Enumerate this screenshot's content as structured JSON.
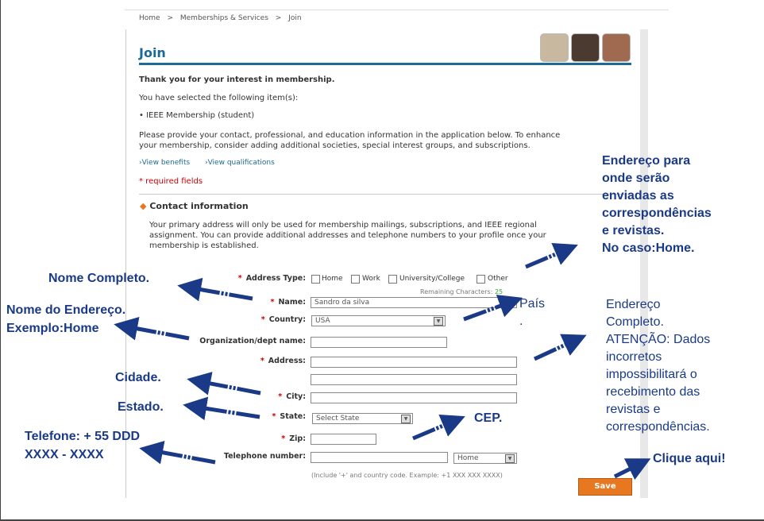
{
  "breadcrumb": {
    "home": "Home",
    "memberships": "Memberships & Services",
    "current": "Join"
  },
  "sep": ">",
  "page": {
    "title": "Join"
  },
  "intro": {
    "thanks": "Thank you for your interest in membership.",
    "selected": "You have selected the following item(s):",
    "item": "IEEE Membership (student)",
    "info1": "Please provide your contact, professional, and education information in the application below. To enhance",
    "info2": "your membership, consider adding additional societies, special interest groups, and subscriptions.",
    "view_benefits": "›View benefits",
    "view_qualifications": "›View qualifications",
    "required": "* required fields"
  },
  "contact": {
    "heading": "Contact information",
    "desc1": "Your primary address will only be used for membership mailings, subscriptions, and IEEE regional",
    "desc2": "assignment. You can provide additional addresses and telephone numbers to your profile once your",
    "desc3": "membership is established."
  },
  "form": {
    "required_marker": "*",
    "address_type_label": "Address Type:",
    "address_types": [
      "Home",
      "Work",
      "University/College",
      "Other"
    ],
    "remaining_label": "Remaining Characters:",
    "remaining_value": "25",
    "name_label": "Name:",
    "name_value": "Sandro da silva",
    "country_label": "Country:",
    "country_value": "USA",
    "org_label": "Organization/dept name:",
    "address_label": "Address:",
    "city_label": "City:",
    "state_label": "State:",
    "state_value": "Select State",
    "zip_label": "Zip:",
    "phone_label": "Telephone number:",
    "phone_type": "Home",
    "phone_hint": "(Include '+' and country code. Example: +1 XXX XXX XXXX)",
    "save": "Save"
  },
  "annotations": {
    "nome_completo": "Nome Completo.",
    "nome_endereco1": "Nome do Endereço.",
    "nome_endereco2": "Exemplo:Home",
    "cidade": "Cidade.",
    "estado": "Estado.",
    "telefone1": "Telefone: + 55 DDD",
    "telefone2": "XXXX - XXXX",
    "pais": "País",
    "pais_dot": ".",
    "cep": "CEP.",
    "clique": "Clique  aqui!",
    "endereco_para": [
      "Endereço para",
      "onde serão",
      "enviadas as",
      "correspondências",
      "e revistas.",
      "No caso:Home."
    ],
    "endereco_completo": [
      "Endereço",
      "Completo.",
      "ATENÇÃO: Dados",
      "incorretos",
      "impossibilitará o",
      "recebimento das",
      "revistas e",
      "correspondências."
    ]
  },
  "colors": {
    "accent": "#1d6a96",
    "annotation": "#1a3a88",
    "save": "#e87722",
    "required": "#cc0000"
  }
}
